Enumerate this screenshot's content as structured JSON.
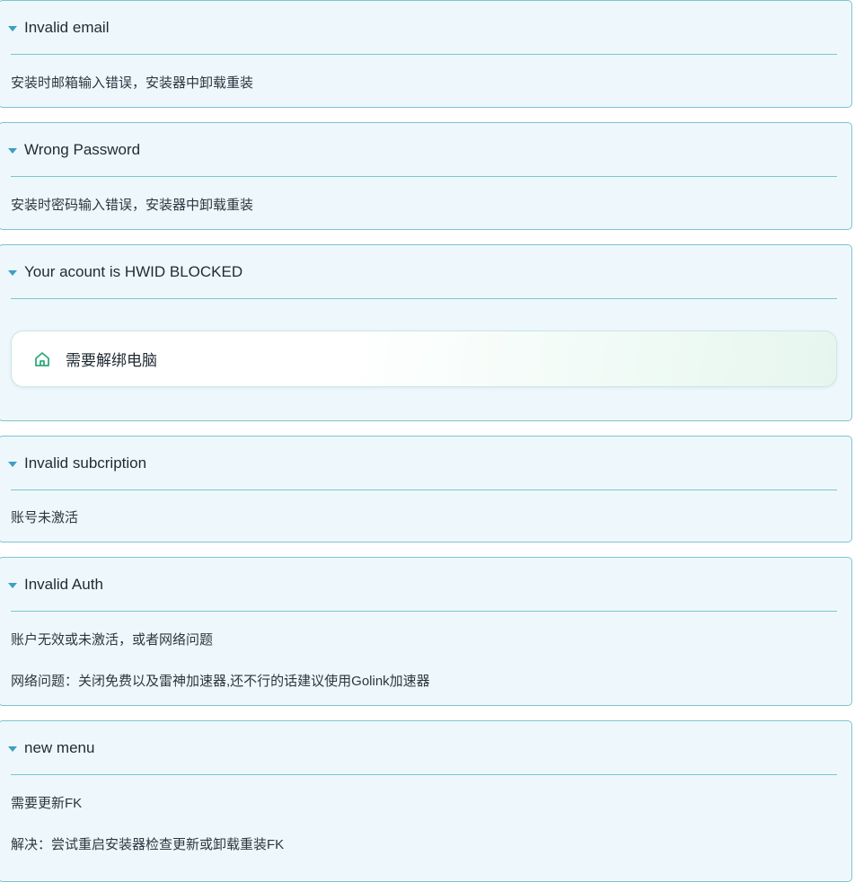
{
  "panels": [
    {
      "title": "Invalid email",
      "lines": [
        "安装时邮箱输入错误，安装器中卸载重装"
      ]
    },
    {
      "title": "Wrong Password",
      "lines": [
        "安装时密码输入错误，安装器中卸载重装"
      ]
    },
    {
      "title": "Your acount is HWID BLOCKED",
      "card": {
        "icon": "home-icon",
        "text": "需要解绑电脑"
      }
    },
    {
      "title": "Invalid subcription",
      "lines": [
        "账号未激活"
      ]
    },
    {
      "title": "Invalid Auth",
      "lines": [
        "账户无效或未激活，或者网络问题",
        "网络问题：关闭免费以及雷神加速器,还不行的话建议使用Golink加速器"
      ]
    },
    {
      "title": "new menu",
      "lines": [
        "需要更新FK",
        "解决：尝试重启安装器检查更新或卸载重装FK"
      ]
    }
  ],
  "colors": {
    "panel_bg": "#eef8fc",
    "border": "#7fc3cf",
    "caret": "#3aa0c4",
    "icon": "#2fa97a"
  }
}
